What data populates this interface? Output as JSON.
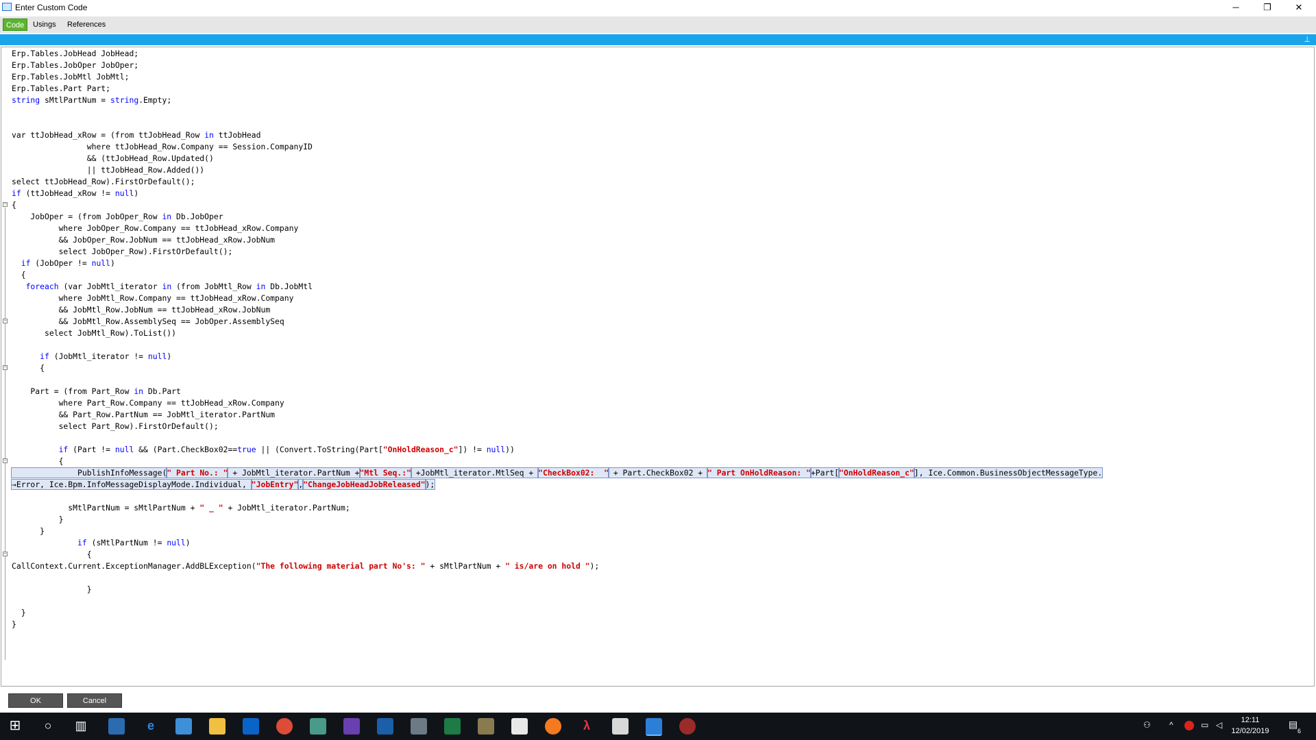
{
  "window": {
    "title": "Enter Custom Code",
    "minimize": "─",
    "restore": "❐",
    "close": "✕"
  },
  "tabs": [
    {
      "label": "Code",
      "active": true
    },
    {
      "label": "Usings",
      "active": false
    },
    {
      "label": "References",
      "active": false
    }
  ],
  "colors": {
    "tab_active": "#5cb531",
    "strip": "#1aa5ea",
    "keyword": "#0000ff",
    "string": "#cc0000"
  },
  "code_lines": [
    [
      {
        "t": "Erp.Tables.JobHead JobHead;"
      }
    ],
    [
      {
        "t": "Erp.Tables.JobOper JobOper;"
      }
    ],
    [
      {
        "t": "Erp.Tables.JobMtl JobMtl;"
      }
    ],
    [
      {
        "t": "Erp.Tables.Part Part;"
      }
    ],
    [
      {
        "t": "string",
        "c": "kw"
      },
      {
        "t": " sMtlPartNum = "
      },
      {
        "t": "string",
        "c": "kw"
      },
      {
        "t": ".Empty;"
      }
    ],
    [],
    [],
    [
      {
        "t": "var ttJobHead_xRow = (from ttJobHead_Row "
      },
      {
        "t": "in",
        "c": "kw"
      },
      {
        "t": " ttJobHead"
      }
    ],
    [
      {
        "t": "                where ttJobHead_Row.Company == Session.CompanyID"
      }
    ],
    [
      {
        "t": "                && (ttJobHead_Row.Updated()"
      }
    ],
    [
      {
        "t": "                || ttJobHead_Row.Added())"
      }
    ],
    [
      {
        "t": "select ttJobHead_Row).FirstOrDefault();"
      }
    ],
    [
      {
        "t": "if",
        "c": "kw"
      },
      {
        "t": " (ttJobHead_xRow != "
      },
      {
        "t": "null",
        "c": "kw"
      },
      {
        "t": ")"
      }
    ],
    [
      {
        "t": "{"
      }
    ],
    [
      {
        "t": "    JobOper = (from JobOper_Row "
      },
      {
        "t": "in",
        "c": "kw"
      },
      {
        "t": " Db.JobOper"
      }
    ],
    [
      {
        "t": "          where JobOper_Row.Company == ttJobHead_xRow.Company"
      }
    ],
    [
      {
        "t": "          && JobOper_Row.JobNum == ttJobHead_xRow.JobNum"
      }
    ],
    [
      {
        "t": "          select JobOper_Row).FirstOrDefault();"
      }
    ],
    [
      {
        "t": "  "
      },
      {
        "t": "if",
        "c": "kw"
      },
      {
        "t": " (JobOper != "
      },
      {
        "t": "null",
        "c": "kw"
      },
      {
        "t": ")"
      }
    ],
    [
      {
        "t": "  {"
      }
    ],
    [
      {
        "t": "   "
      },
      {
        "t": "foreach",
        "c": "kw"
      },
      {
        "t": " (var JobMtl_iterator "
      },
      {
        "t": "in",
        "c": "kw"
      },
      {
        "t": " (from JobMtl_Row "
      },
      {
        "t": "in",
        "c": "kw"
      },
      {
        "t": " Db.JobMtl"
      }
    ],
    [
      {
        "t": "          where JobMtl_Row.Company == ttJobHead_xRow.Company"
      }
    ],
    [
      {
        "t": "          && JobMtl_Row.JobNum == ttJobHead_xRow.JobNum"
      }
    ],
    [
      {
        "t": "          && JobMtl_Row.AssemblySeq == JobOper.AssemblySeq"
      }
    ],
    [
      {
        "t": "       select JobMtl_Row).ToList())"
      }
    ],
    [],
    [
      {
        "t": "      "
      },
      {
        "t": "if",
        "c": "kw"
      },
      {
        "t": " (JobMtl_iterator != "
      },
      {
        "t": "null",
        "c": "kw"
      },
      {
        "t": ")"
      }
    ],
    [
      {
        "t": "      {"
      }
    ],
    [],
    [
      {
        "t": "    Part = (from Part_Row "
      },
      {
        "t": "in",
        "c": "kw"
      },
      {
        "t": " Db.Part"
      }
    ],
    [
      {
        "t": "          where Part_Row.Company == ttJobHead_xRow.Company"
      }
    ],
    [
      {
        "t": "          && Part_Row.PartNum == JobMtl_iterator.PartNum"
      }
    ],
    [
      {
        "t": "          select Part_Row).FirstOrDefault();"
      }
    ],
    [],
    [
      {
        "t": "          "
      },
      {
        "t": "if",
        "c": "kw"
      },
      {
        "t": " (Part != "
      },
      {
        "t": "null",
        "c": "kw"
      },
      {
        "t": " && (Part.CheckBox02=="
      },
      {
        "t": "true",
        "c": "kw"
      },
      {
        "t": " || (Convert.ToString(Part["
      },
      {
        "t": "\"OnHoldReason_c\"",
        "c": "str"
      },
      {
        "t": "]) != "
      },
      {
        "t": "null",
        "c": "kw"
      },
      {
        "t": "))"
      }
    ],
    [
      {
        "t": "          {"
      }
    ],
    [
      {
        "t": "              PublishInfoMessage(",
        "sel": true
      },
      {
        "t": "\" Part No.: \"",
        "c": "str",
        "sel": true
      },
      {
        "t": " + JobMtl_iterator.PartNum +",
        "sel": true
      },
      {
        "t": "\"Mtl Seq.:\"",
        "c": "str",
        "sel": true
      },
      {
        "t": " +JobMtl_iterator.MtlSeq + ",
        "sel": true
      },
      {
        "t": "\"CheckBox02:  \"",
        "c": "str",
        "sel": true
      },
      {
        "t": " + Part.CheckBox02 + ",
        "sel": true
      },
      {
        "t": "\" Part OnHoldReason: \"",
        "c": "str",
        "sel": true
      },
      {
        "t": "+Part[",
        "sel": true
      },
      {
        "t": "\"OnHoldReason_c\"",
        "c": "str",
        "sel": true
      },
      {
        "t": "], Ice.Common.BusinessObjectMessageType.",
        "sel": true
      }
    ],
    [
      {
        "t": "→Error, Ice.Bpm.InfoMessageDisplayMode.Individual, ",
        "sel": true
      },
      {
        "t": "\"JobEntry\"",
        "c": "str",
        "sel": true
      },
      {
        "t": ",",
        "sel": true
      },
      {
        "t": "\"ChangeJobHeadJobReleased\"",
        "c": "str",
        "sel": true
      },
      {
        "t": ");",
        "sel": true
      }
    ],
    [],
    [
      {
        "t": "            sMtlPartNum = sMtlPartNum + "
      },
      {
        "t": "\" _ \"",
        "c": "str"
      },
      {
        "t": " + JobMtl_iterator.PartNum;"
      }
    ],
    [
      {
        "t": "          }"
      }
    ],
    [
      {
        "t": "      }"
      }
    ],
    [
      {
        "t": "              "
      },
      {
        "t": "if",
        "c": "kw"
      },
      {
        "t": " (sMtlPartNum != "
      },
      {
        "t": "null",
        "c": "kw"
      },
      {
        "t": ")"
      }
    ],
    [
      {
        "t": "                {"
      }
    ],
    [
      {
        "t": "CallContext.Current.ExceptionManager.AddBLException("
      },
      {
        "t": "\"The following material part No's: \"",
        "c": "str"
      },
      {
        "t": " + sMtlPartNum + "
      },
      {
        "t": "\" is/are on hold \"",
        "c": "str"
      },
      {
        "t": ");"
      }
    ],
    [],
    [
      {
        "t": "                }"
      }
    ],
    [],
    [
      {
        "t": "  }"
      }
    ],
    [
      {
        "t": "}"
      }
    ]
  ],
  "buttons": {
    "ok": "OK",
    "cancel": "Cancel"
  },
  "taskbar": {
    "time": "12:11",
    "date": "12/02/2019",
    "notification_count": "6"
  }
}
